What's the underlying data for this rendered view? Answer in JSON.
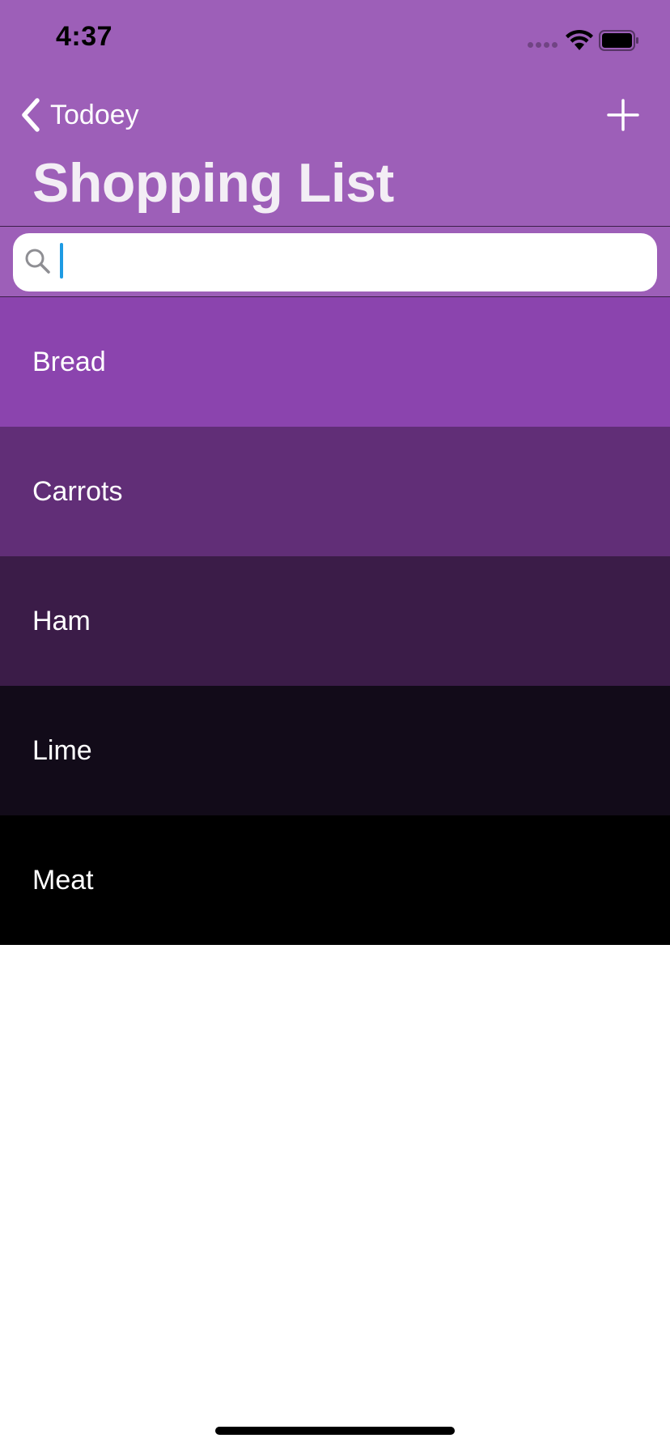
{
  "status_bar": {
    "time": "4:37"
  },
  "nav": {
    "back_label": "Todoey",
    "back_icon": "chevron-left-icon",
    "add_icon": "plus-icon"
  },
  "header": {
    "title": "Shopping List",
    "background_color": "#9d5fb8"
  },
  "search": {
    "value": "",
    "placeholder": "",
    "icon": "search-icon"
  },
  "items": [
    {
      "label": "Bread",
      "color": "#8b44ae"
    },
    {
      "label": "Carrots",
      "color": "#612e77"
    },
    {
      "label": "Ham",
      "color": "#3b1c48"
    },
    {
      "label": "Lime",
      "color": "#120b19"
    },
    {
      "label": "Meat",
      "color": "#000000"
    }
  ],
  "colors": {
    "accent": "#9d5fb8",
    "cursor": "#1e9be3",
    "text_light": "#ffffff"
  }
}
